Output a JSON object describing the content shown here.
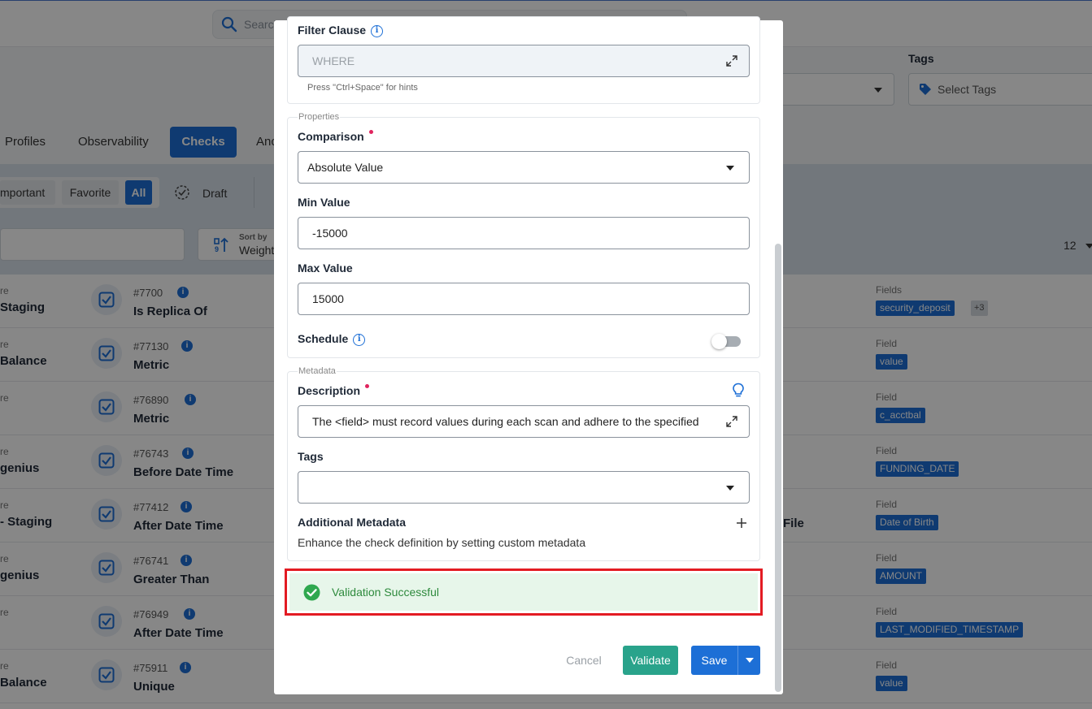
{
  "background": {
    "search_placeholder": "Search",
    "tags_label": "Tags",
    "tags_placeholder": "Select Tags",
    "tabs": [
      "Profiles",
      "Observability",
      "Checks",
      "Anc"
    ],
    "filter_pills": [
      "mportant",
      "Favorite",
      "All"
    ],
    "draft_label": "Draft",
    "sort_label": "Sort by",
    "sort_value": "Weight",
    "page_count": "12",
    "rows": [
      {
        "source_label": "re",
        "source": "Staging",
        "number": "#7700",
        "name": "Is Replica Of",
        "mid": "",
        "field_label": "Fields",
        "field_value": "security_deposit",
        "more": "+3"
      },
      {
        "source_label": "re",
        "source": "Balance",
        "number": "#77130",
        "name": "Metric",
        "mid": "",
        "field_label": "Field",
        "field_value": "value",
        "more": ""
      },
      {
        "source_label": "re",
        "source": "",
        "number": "#76890",
        "name": "Metric",
        "mid": "",
        "field_label": "Field",
        "field_value": "c_acctbal",
        "more": ""
      },
      {
        "source_label": "re",
        "source": "genius",
        "number": "#76743",
        "name": "Before Date Time",
        "mid": "",
        "field_label": "Field",
        "field_value": "FUNDING_DATE",
        "more": ""
      },
      {
        "source_label": "re",
        "source": "- Staging",
        "number": "#77412",
        "name": "After Date Time",
        "mid": "File",
        "field_label": "Field",
        "field_value": "Date of Birth",
        "more": ""
      },
      {
        "source_label": "re",
        "source": "genius",
        "number": "#76741",
        "name": "Greater Than",
        "mid": "",
        "field_label": "Field",
        "field_value": "AMOUNT",
        "more": ""
      },
      {
        "source_label": "re",
        "source": "",
        "number": "#76949",
        "name": "After Date Time",
        "mid": "",
        "field_label": "Field",
        "field_value": "LAST_MODIFIED_TIMESTAMP",
        "more": ""
      },
      {
        "source_label": "re",
        "source": "Balance",
        "number": "#75911",
        "name": "Unique",
        "mid": "",
        "field_label": "Field",
        "field_value": "value",
        "more": ""
      }
    ]
  },
  "modal": {
    "filter_clause_label": "Filter Clause",
    "filter_clause_placeholder": "WHERE",
    "filter_hint": "Press \"Ctrl+Space\" for hints",
    "properties_legend": "Properties",
    "comparison_label": "Comparison",
    "comparison_value": "Absolute Value",
    "min_value_label": "Min Value",
    "min_value": "-15000",
    "max_value_label": "Max Value",
    "max_value": "15000",
    "schedule_label": "Schedule",
    "schedule_enabled": false,
    "metadata_legend": "Metadata",
    "description_label": "Description",
    "description_value": "The <field> must record values during each scan and adhere to the specified",
    "tags_label": "Tags",
    "tags_value": "",
    "additional_metadata_label": "Additional Metadata",
    "additional_metadata_hint": "Enhance the check definition by setting custom metadata",
    "validation_message": "Validation Successful",
    "cancel_label": "Cancel",
    "validate_label": "Validate",
    "save_label": "Save"
  },
  "colors": {
    "primary": "#1d6fd6",
    "validate": "#29a38b",
    "success_bg": "#e7f6ea",
    "success_text": "#2e8a3d",
    "highlight_border": "#e31b23",
    "required_dot": "#e0245e"
  }
}
